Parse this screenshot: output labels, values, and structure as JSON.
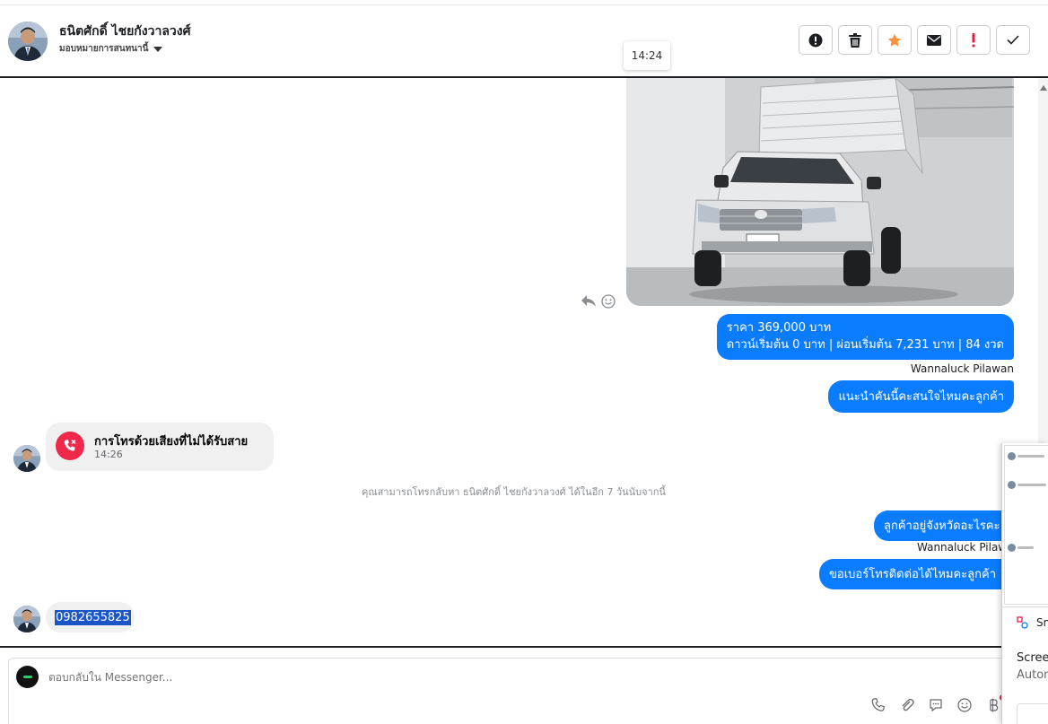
{
  "header": {
    "contact_name": "ธนิตศักดิ์ ไชยกังวาลวงศ์",
    "assign_label": "มอบหมายการสนทนานี้",
    "actions": [
      "report-icon",
      "trash-icon",
      "star-icon",
      "mail-icon",
      "important-icon",
      "check-icon"
    ],
    "star_color": "#f7923b",
    "important_color": "#e41e3f"
  },
  "tooltip_time": "14:24",
  "messages": {
    "price_line1": "ราคา 369,000 บาท",
    "price_line2": "ดาวน์เริ่มต้น 0 บาท | ผ่อนเริ่มต้น 7,231 บาท | 84 งวด",
    "sender": "Wannaluck Pilawan",
    "recommend": "แนะนำคันนี้คะสนใจไหมคะลูกค้า",
    "missed_call_title": "การโทรด้วยเสียงที่ไม่ได้รับสาย",
    "missed_call_time": "14:26",
    "callback_note": "คุณสามารถโทรกลับหา ธนิตศักดิ์ ไชยกังวาลวงศ์ ได้ในอีก 7 วันนับจากนี้",
    "ask_province": "ลูกค้าอยู่จังหวัดอะไรคะ",
    "sender_truncated": "Wannaluck Pilawa",
    "ask_phone": "ขอเบอร์โทรติดต่อได้ไหมคะลูกค้า",
    "phone_number": "0982655825",
    "bubble_color": "#0a7cff",
    "missed_call_color": "#f02849"
  },
  "composer": {
    "placeholder": "ตอบกลับใน Messenger...",
    "tools": [
      "phone-icon",
      "paperclip-icon",
      "comment-icon",
      "emoji-icon",
      "baht-icon"
    ]
  },
  "side_panel": {
    "app_label": "Sn",
    "title": "Screen",
    "subtitle": "Autom"
  }
}
